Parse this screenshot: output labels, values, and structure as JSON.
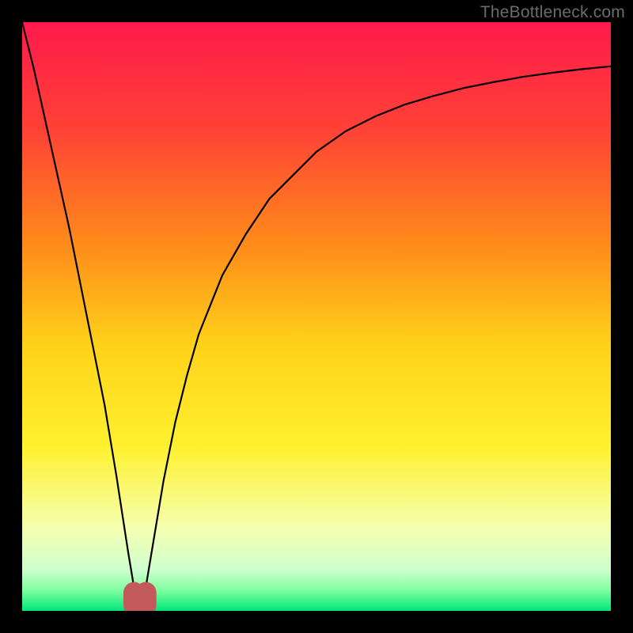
{
  "watermark": "TheBottleneck.com",
  "chart_data": {
    "type": "line",
    "title": "",
    "xlabel": "",
    "ylabel": "",
    "xrange": [
      0,
      100
    ],
    "yrange": [
      0,
      100
    ],
    "grid": false,
    "legend": false,
    "background_gradient": {
      "direction": "vertical",
      "stops": [
        {
          "pos": 0.0,
          "color": "#ff1a4b"
        },
        {
          "pos": 0.18,
          "color": "#ff4136"
        },
        {
          "pos": 0.38,
          "color": "#ff8c1a"
        },
        {
          "pos": 0.55,
          "color": "#ffd21a"
        },
        {
          "pos": 0.72,
          "color": "#fff12e"
        },
        {
          "pos": 0.86,
          "color": "#f5ffb0"
        },
        {
          "pos": 0.93,
          "color": "#cfffcf"
        },
        {
          "pos": 0.965,
          "color": "#7fff9f"
        },
        {
          "pos": 1.0,
          "color": "#00e67a"
        }
      ]
    },
    "curve": {
      "color": "#000000",
      "width": 2.2,
      "x": [
        0,
        2,
        4,
        6,
        8,
        10,
        12,
        14,
        16,
        18,
        19,
        19.5,
        20,
        20.5,
        21,
        22,
        24,
        26,
        28,
        30,
        34,
        38,
        42,
        46,
        50,
        55,
        60,
        65,
        70,
        75,
        80,
        85,
        90,
        95,
        100
      ],
      "y": [
        100,
        92,
        83,
        74,
        65,
        55,
        45,
        35,
        23,
        10,
        4,
        1.5,
        0.6,
        1.5,
        4,
        10,
        22,
        32,
        40,
        47,
        57,
        64,
        70,
        74,
        78,
        81.5,
        84,
        86,
        87.5,
        88.8,
        89.8,
        90.7,
        91.4,
        92,
        92.5
      ]
    },
    "marker_band": {
      "color": "#c25a5a",
      "y": 0.6,
      "x_start": 19.0,
      "x_end": 21.0,
      "thickness": 3.6
    }
  }
}
